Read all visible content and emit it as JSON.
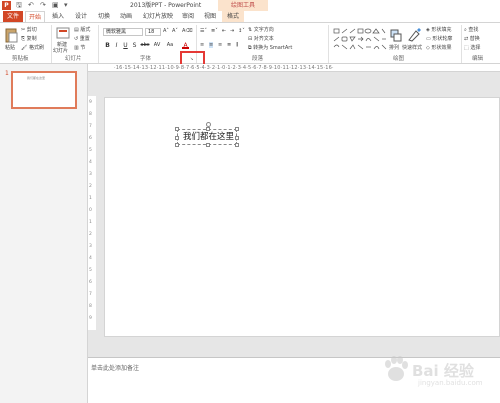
{
  "titlebar": {
    "app_logo": "P",
    "title": "2013版PPT - PowerPoint",
    "context_header": "绘图工具",
    "window_controls": "? ▢ — ▢ ✕"
  },
  "tabs": {
    "file": "文件",
    "home": "开始",
    "insert": "插入",
    "design": "设计",
    "transitions": "切换",
    "animations": "动画",
    "slideshow": "幻灯片放映",
    "review": "审阅",
    "view": "视图",
    "format": "格式"
  },
  "ribbon": {
    "clipboard": {
      "paste": "粘贴",
      "cut": "剪切",
      "copy": "复制",
      "format_painter": "格式刷",
      "label": "剪贴板"
    },
    "slides": {
      "new_slide": "新建",
      "new_slide2": "幻灯片",
      "layout": "版式",
      "reset": "重置",
      "section": "节",
      "label": "幻灯片"
    },
    "font": {
      "font_name": "微软雅黑",
      "font_size": "18",
      "label": "字体",
      "bold": "B",
      "italic": "I",
      "underline": "U",
      "strike": "S",
      "shadow": "abc",
      "spacing": "AV",
      "case": "Aa",
      "color": "A"
    },
    "paragraph": {
      "text_direction": "文字方向",
      "align_text": "对齐文本",
      "smartart": "转换为 SmartArt",
      "label": "段落"
    },
    "drawing": {
      "arrange": "排列",
      "quick_styles": "快速样式",
      "shape_fill": "形状填充",
      "shape_outline": "形状轮廓",
      "shape_effects": "形状效果",
      "label": "绘图"
    },
    "editing": {
      "find": "查找",
      "replace": "替换",
      "select": "选择",
      "label": "编辑"
    }
  },
  "ruler": {
    "horizontal": "·16·15·14·13·12·11·10·9·8·7·6·5·4·3·2·1·0·1·2·3·4·5·6·7·8·9·10·11·12·13·14·15·16·",
    "vertical": [
      "9",
      "8",
      "7",
      "6",
      "5",
      "4",
      "3",
      "2",
      "1",
      "0",
      "1",
      "2",
      "3",
      "4",
      "5",
      "6",
      "7",
      "8",
      "9"
    ]
  },
  "thumbnail": {
    "number": "1",
    "text": "我们都在这里"
  },
  "slide": {
    "textbox": "我们都在这里"
  },
  "notes": {
    "placeholder": "单击此处添加备注"
  },
  "watermark": {
    "text": "Bai 经验",
    "sub": "jingyan.baidu.com"
  },
  "colors": {
    "accent": "#d24726",
    "context": "#fbe3cc",
    "highlight_box": "#e53935"
  }
}
